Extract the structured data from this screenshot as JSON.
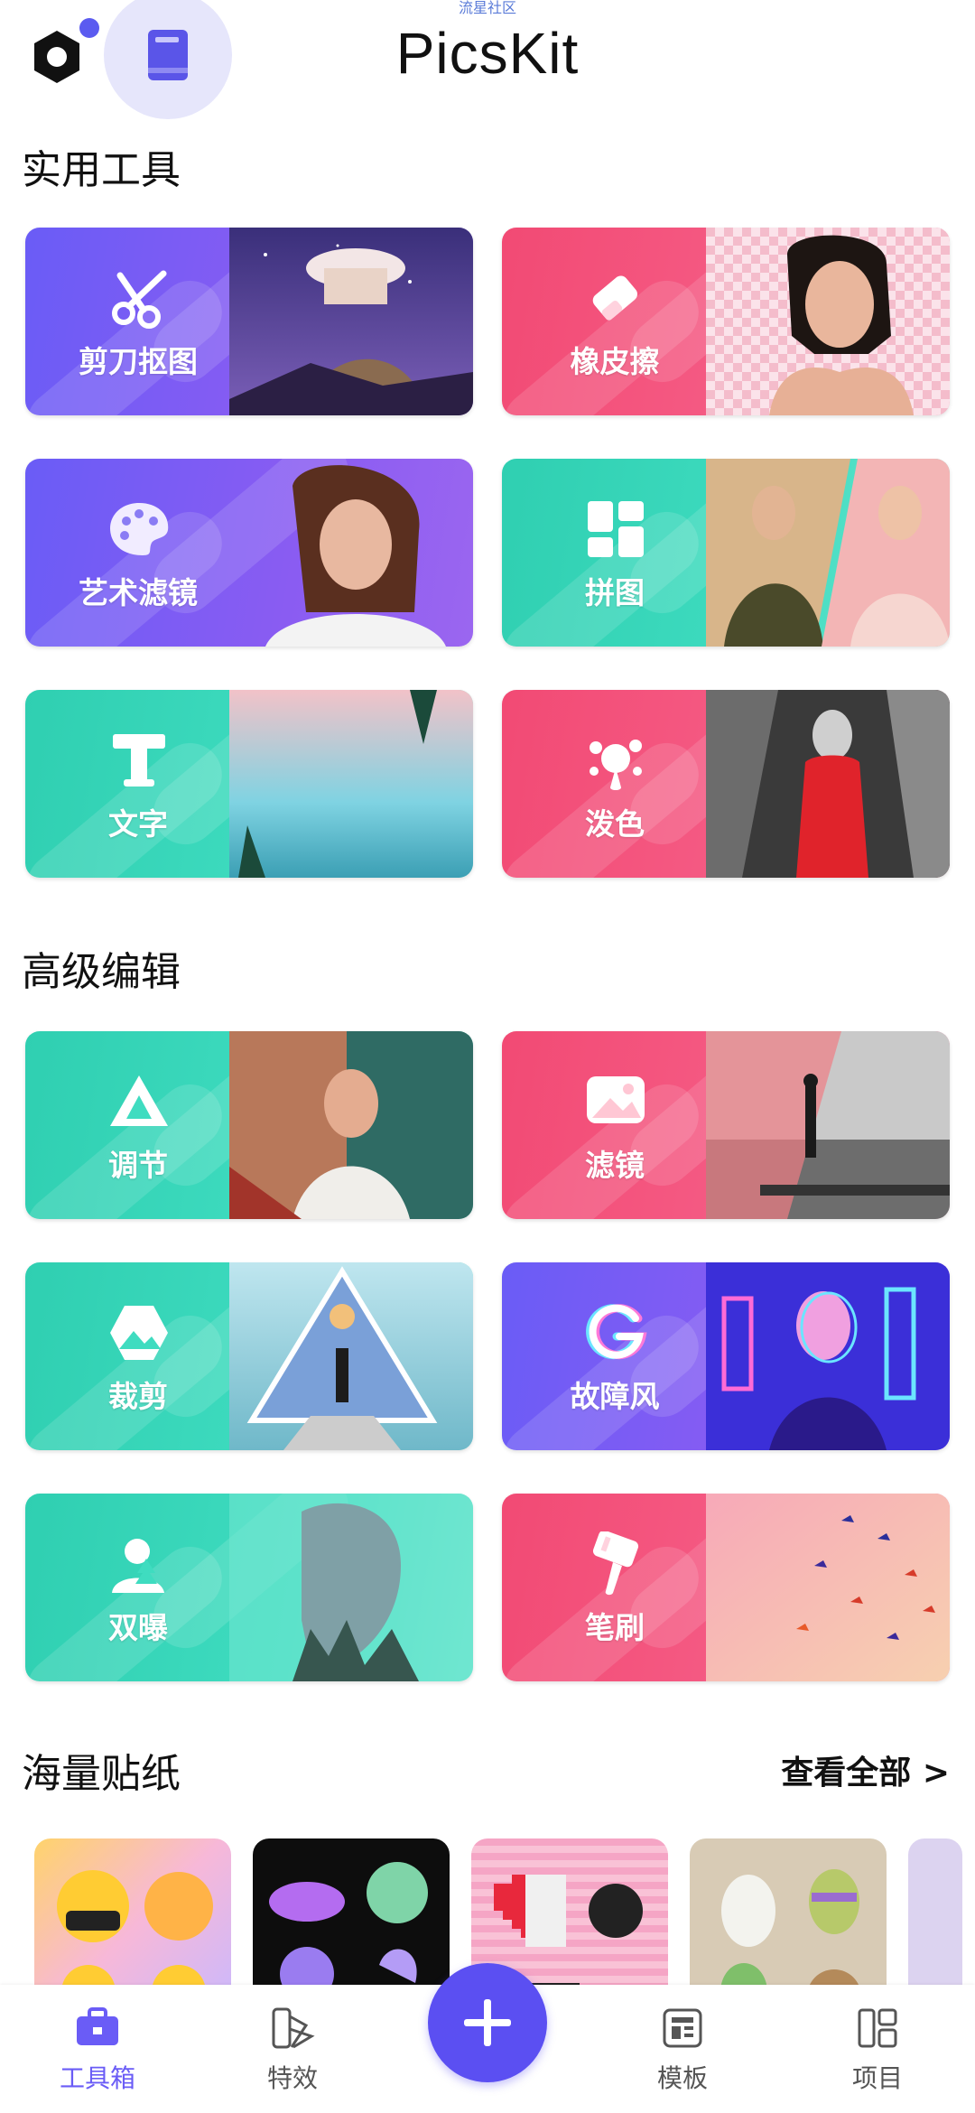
{
  "watermark": "流星社区",
  "header": {
    "title": "PicsKit"
  },
  "sections": {
    "tools_title": "实用工具",
    "advanced_title": "高级编辑",
    "stickers_title": "海量贴纸",
    "see_all": "查看全部 >"
  },
  "tools": [
    {
      "label": "剪刀抠图",
      "icon": "scissors-icon",
      "theme": "purple"
    },
    {
      "label": "橡皮擦",
      "icon": "eraser-icon",
      "theme": "pink"
    },
    {
      "label": "艺术滤镜",
      "icon": "palette-icon",
      "theme": "purple"
    },
    {
      "label": "拼图",
      "icon": "collage-icon",
      "theme": "teal"
    },
    {
      "label": "文字",
      "icon": "text-icon",
      "theme": "teal"
    },
    {
      "label": "泼色",
      "icon": "splash-icon",
      "theme": "pink"
    }
  ],
  "advanced": [
    {
      "label": "调节",
      "icon": "adjust-icon",
      "theme": "teal"
    },
    {
      "label": "滤镜",
      "icon": "filter-icon",
      "theme": "pink"
    },
    {
      "label": "裁剪",
      "icon": "crop-icon",
      "theme": "teal"
    },
    {
      "label": "故障风",
      "icon": "glitch-icon",
      "theme": "purple"
    },
    {
      "label": "双曝",
      "icon": "double-exposure-icon",
      "theme": "teal"
    },
    {
      "label": "笔刷",
      "icon": "brush-icon",
      "theme": "pink"
    }
  ],
  "tabbar": [
    {
      "label": "工具箱",
      "icon": "toolbox-icon",
      "active": true
    },
    {
      "label": "特效",
      "icon": "effects-icon",
      "active": false
    },
    {
      "label": "模板",
      "icon": "template-icon",
      "active": false
    },
    {
      "label": "项目",
      "icon": "project-icon",
      "active": false
    }
  ],
  "colors": {
    "accent": "#5b4ff2",
    "purple": "#6a5cf6",
    "pink": "#f24a74",
    "teal": "#2fcfb1"
  }
}
